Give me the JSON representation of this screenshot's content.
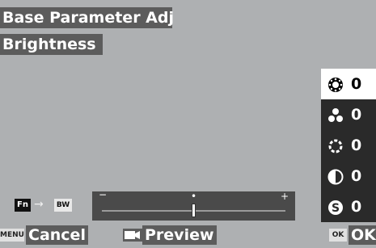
{
  "header": {
    "title": "Base Parameter Adj",
    "subtitle": "Brightness"
  },
  "params": [
    {
      "icon": "brightness-icon",
      "value": "0",
      "selected": true
    },
    {
      "icon": "saturation-icon",
      "value": "0",
      "selected": false
    },
    {
      "icon": "hue-icon",
      "value": "0",
      "selected": false
    },
    {
      "icon": "contrast-icon",
      "value": "0",
      "selected": false
    },
    {
      "icon": "sharpness-icon",
      "value": "0",
      "selected": false
    }
  ],
  "fn_shortcut": {
    "fn_label": "Fn",
    "arrow": "→",
    "bw_label": "BW"
  },
  "slider": {
    "minus": "−",
    "plus": "+",
    "level": 0.5
  },
  "footer": {
    "cancel": {
      "badge": "MENU",
      "label": "Cancel"
    },
    "preview": {
      "label": "Preview"
    },
    "ok": {
      "badge": "OK",
      "label": "OK"
    }
  },
  "colors": {
    "background": "#aeb0b2",
    "label_bg": "#5c5c5c",
    "panel_bg": "#2a2a2a",
    "selected_bg": "#ffffff"
  }
}
